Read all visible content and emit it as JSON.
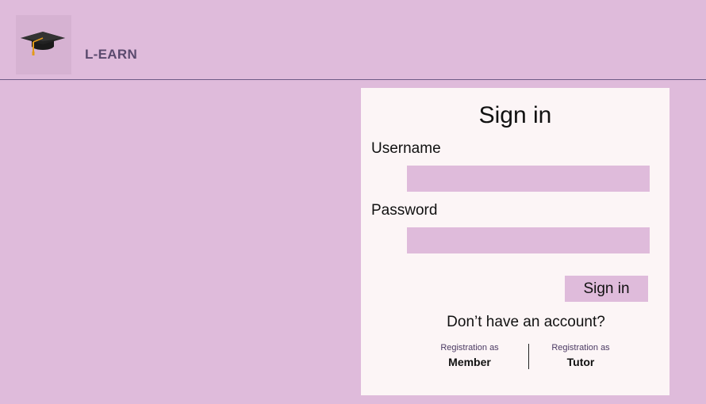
{
  "header": {
    "logo_icon": "graduation-cap-icon",
    "brand": "L-EARN"
  },
  "signin": {
    "title": "Sign in",
    "username_label": "Username",
    "username_value": "",
    "password_label": "Password",
    "password_value": "",
    "button_label": "Sign in",
    "no_account_text": "Don’t have an account?",
    "register_member": {
      "caption": "Registration as",
      "role": "Member"
    },
    "register_tutor": {
      "caption": "Registration as",
      "role": "Tutor"
    }
  },
  "colors": {
    "background": "#dfbbdb",
    "card": "#fcf5f6",
    "brand_text": "#5b4a6e",
    "header_rule": "#6d5a86"
  }
}
